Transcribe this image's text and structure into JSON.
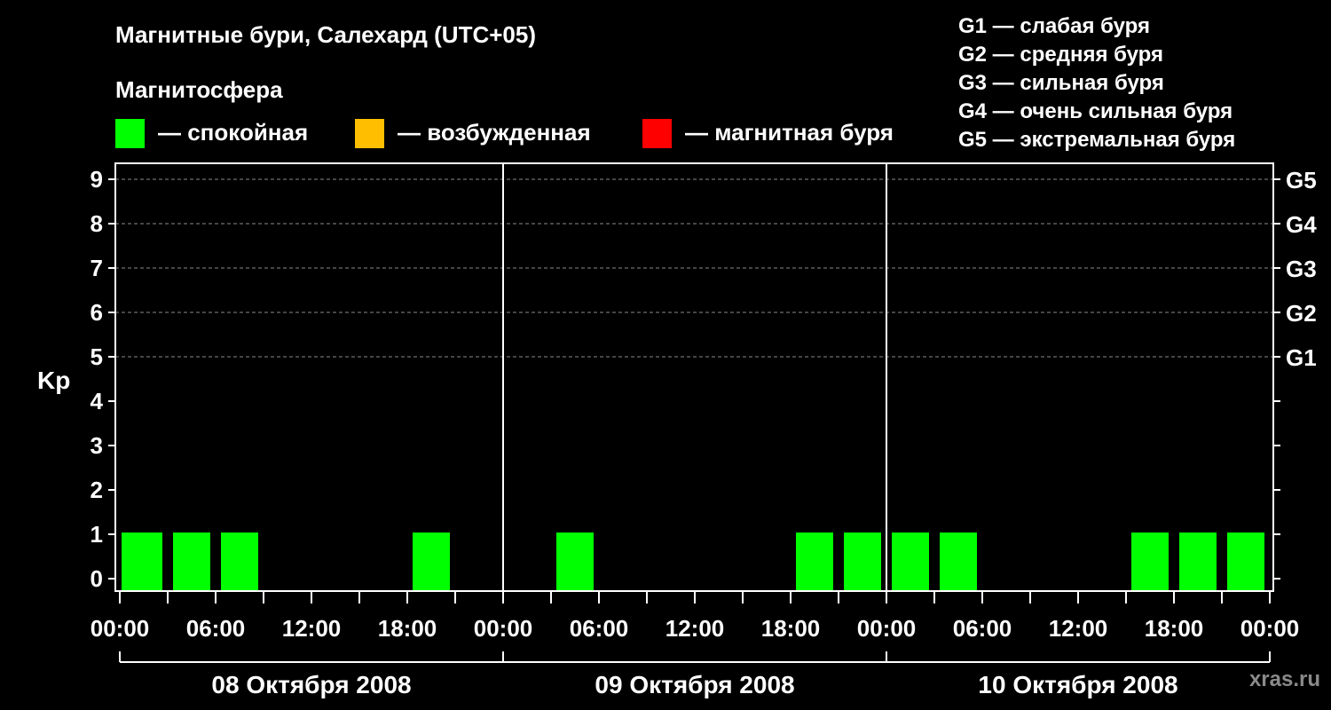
{
  "title": "Магнитные бури, Салехард (UTC+05)",
  "magnetosphere": {
    "heading": "Магнитосфера",
    "items": [
      {
        "label": "— спокойная",
        "color": "#00ff00"
      },
      {
        "label": "— возбужденная",
        "color": "#ffbf00"
      },
      {
        "label": "— магнитная буря",
        "color": "#ff0000"
      }
    ]
  },
  "storm_levels": [
    "G1 — слабая буря",
    "G2 — средняя буря",
    "G3 — сильная буря",
    "G4 — очень сильная буря",
    "G5 — экстремальная буря"
  ],
  "watermark": "xras.ru",
  "chart_data": {
    "type": "bar",
    "ylabel": "Kp",
    "ylim": [
      0,
      9
    ],
    "yticks": [
      "0",
      "1",
      "2",
      "3",
      "4",
      "5",
      "6",
      "7",
      "8",
      "9"
    ],
    "right_ticks": [
      {
        "value": 5,
        "label": "G1"
      },
      {
        "value": 6,
        "label": "G2"
      },
      {
        "value": 7,
        "label": "G3"
      },
      {
        "value": 8,
        "label": "G4"
      },
      {
        "value": 9,
        "label": "G5"
      }
    ],
    "x_tick_labels": [
      "00:00",
      "06:00",
      "12:00",
      "18:00",
      "00:00",
      "06:00",
      "12:00",
      "18:00",
      "00:00",
      "06:00",
      "12:00",
      "18:00",
      "00:00"
    ],
    "days": [
      "08 Октября 2008",
      "09 Октября 2008",
      "10 Октября 2008"
    ],
    "interval_hours": 3,
    "grid": "dashed at Kp 5–9",
    "colors": {
      "quiet": "#00ff00",
      "active": "#ffbf00",
      "storm": "#ff0000"
    },
    "series": [
      {
        "date": "08 Октября 2008",
        "values": [
          1,
          1,
          1,
          0,
          0,
          0,
          1,
          0
        ]
      },
      {
        "date": "09 Октября 2008",
        "values": [
          0,
          1,
          0,
          0,
          0,
          0,
          1,
          1
        ]
      },
      {
        "date": "10 Октября 2008",
        "values": [
          1,
          1,
          0,
          0,
          0,
          1,
          1,
          1
        ]
      }
    ]
  }
}
